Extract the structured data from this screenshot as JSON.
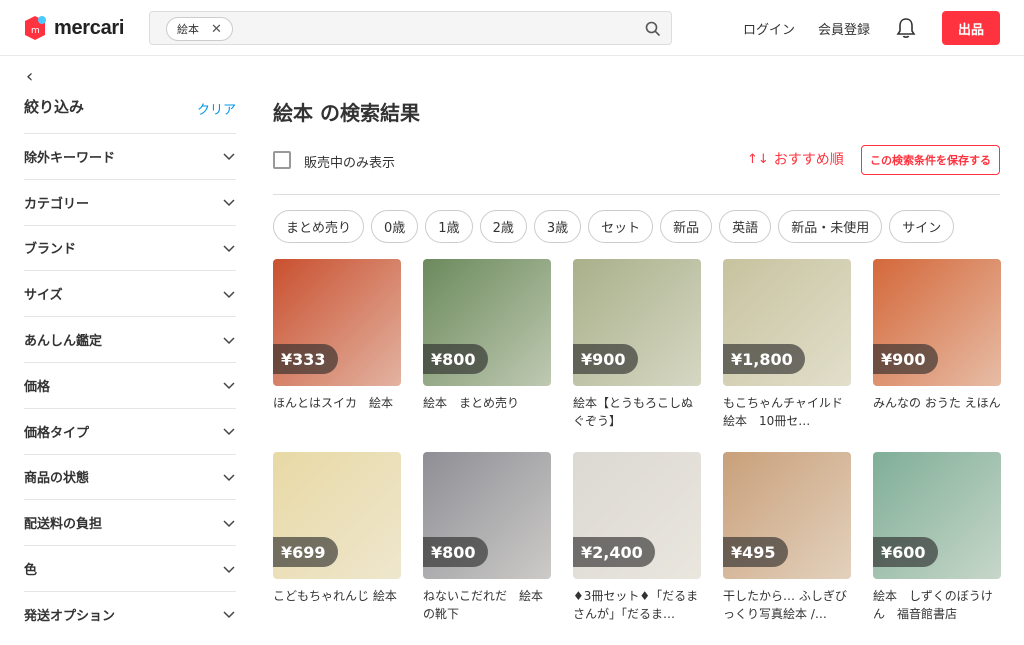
{
  "header": {
    "logo_text": "mercari",
    "search_chip": "絵本",
    "login": "ログイン",
    "register": "会員登録",
    "sell": "出品"
  },
  "sidebar": {
    "title": "絞り込み",
    "clear": "クリア",
    "filters": [
      "除外キーワード",
      "カテゴリー",
      "ブランド",
      "サイズ",
      "あんしん鑑定",
      "価格",
      "価格タイプ",
      "商品の状態",
      "配送料の負担",
      "色",
      "発送オプション"
    ]
  },
  "main": {
    "title": "絵本 の検索結果",
    "on_sale_only": "販売中のみ表示",
    "sort": "おすすめ順",
    "save_search": "この検索条件を保存する",
    "tags": [
      "まとめ売り",
      "0歳",
      "1歳",
      "2歳",
      "3歳",
      "セット",
      "新品",
      "英語",
      "新品・未使用",
      "サイン"
    ]
  },
  "items": [
    {
      "price": "¥333",
      "name": "ほんとはスイカ　絵本",
      "color": "#c9502f"
    },
    {
      "price": "¥800",
      "name": "絵本　まとめ売り",
      "color": "#6b8a5c"
    },
    {
      "price": "¥900",
      "name": "絵本【とうもろこしぬぐぞう】",
      "color": "#a9b08a"
    },
    {
      "price": "¥1,800",
      "name": "もこちゃんチャイルド　絵本　10冊セ…",
      "color": "#c7c39f"
    },
    {
      "price": "¥900",
      "name": "みんなの おうた えほん",
      "color": "#d4683a"
    },
    {
      "price": "¥699",
      "name": "こどもちゃれんじ 絵本",
      "color": "#e8d9a5"
    },
    {
      "price": "¥800",
      "name": "ねないこだれだ　絵本の靴下",
      "color": "#8e8e95"
    },
    {
      "price": "¥2,400",
      "name": "♦3冊セット♦「だるまさんが」「だるま…",
      "color": "#dcd8d2"
    },
    {
      "price": "¥495",
      "name": "干したから… ふしぎびっくり写真絵本 /…",
      "color": "#c9a07a"
    },
    {
      "price": "¥600",
      "name": "絵本　しずくのぼうけん　福音館書店",
      "color": "#7fae98"
    }
  ]
}
